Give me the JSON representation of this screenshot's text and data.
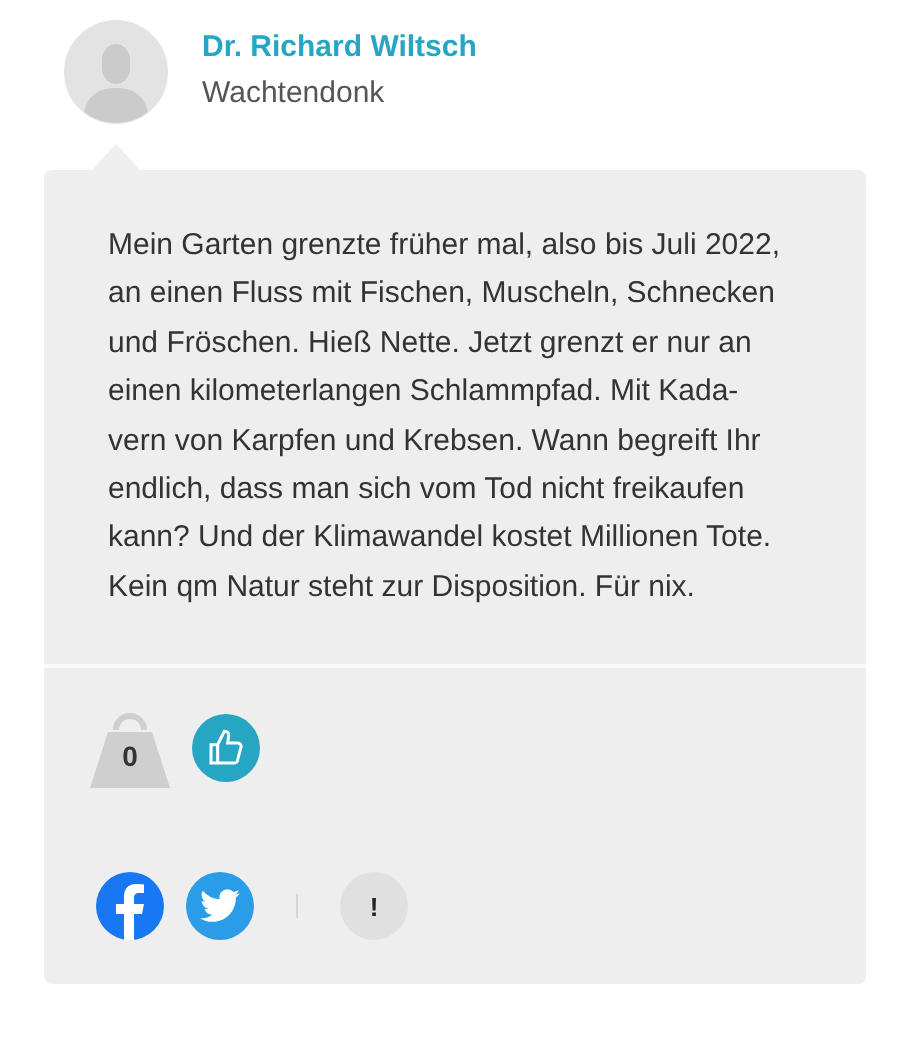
{
  "author": {
    "name": "Dr. Richard Wiltsch",
    "location": "Wachtendonk"
  },
  "comment": {
    "lines": [
      "Mein Garten grenzte früher mal, also bis Juli 2022,",
      "an einen Fluss mit Fischen, Muscheln, Schnecken",
      "und Fröschen. Hieß Nette. Jetzt grenzt er nur an",
      "einen kilometerlangen Schlammpfad. Mit Kada-",
      "vern von Karpfen und Krebsen. Wann begreift Ihr",
      "endlich, dass man sich vom Tod nicht freikaufen",
      "kann? Und der Klimawandel kostet Millionen Tote.",
      "Kein qm Natur steht zur Disposition. Für nix."
    ]
  },
  "rating": {
    "weight_count": "0"
  },
  "actions": {
    "report_label": "!"
  }
}
